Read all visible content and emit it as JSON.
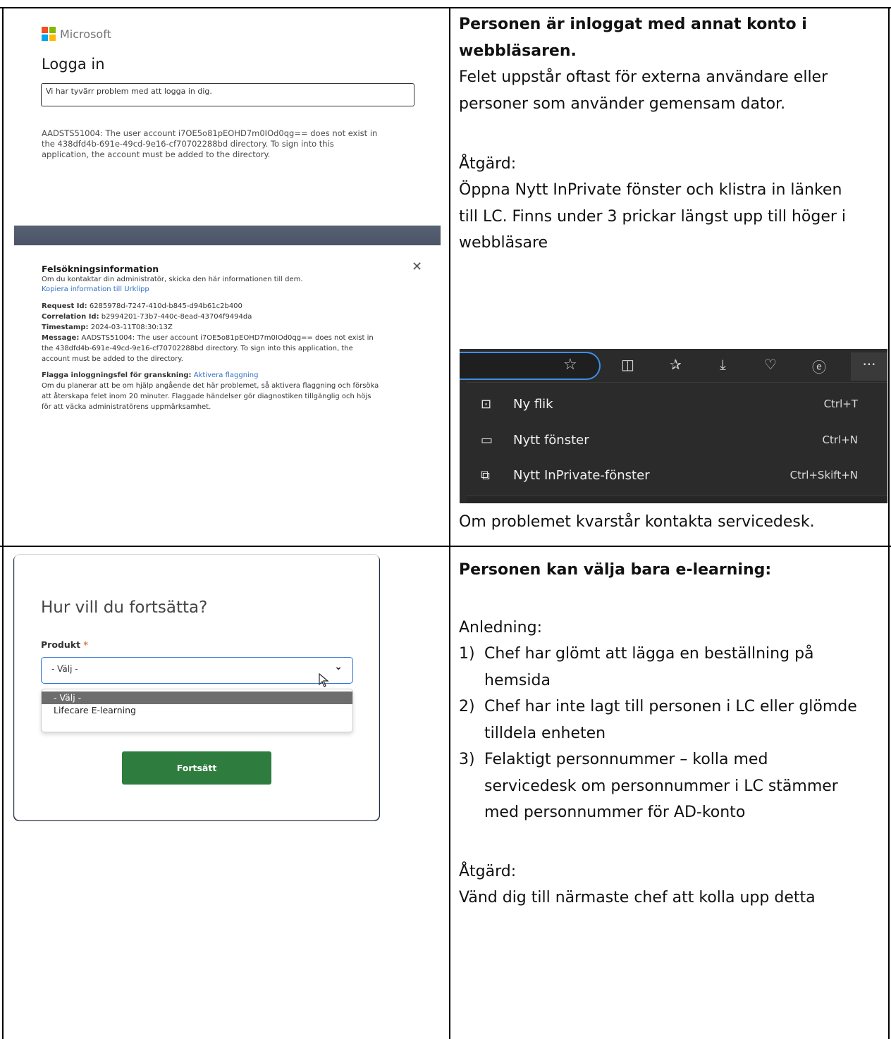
{
  "row1": {
    "heading": [
      "Personen är inloggat med annat konto i",
      "webbläsaren."
    ],
    "paragraph": [
      "Felet uppstår oftast för externa användare eller",
      "personer som använder gemensam dator."
    ],
    "action_label": "Åtgärd:",
    "action_text": [
      "Öppna Nytt InPrivate fönster och klistra in länken",
      "till LC. Finns under 3 prickar längst upp till höger i",
      "webbläsare"
    ],
    "footer": "Om problemet kvarstår kontakta servicedesk."
  },
  "ms_signin": {
    "brand": "Microsoft",
    "title": "Logga in",
    "error_box": "Vi har tyvärr problem med att logga in dig.",
    "error_lines": [
      "AADSTS51004: The user account i7OE5o81pEOHD7m0IOd0qg== does not exist in",
      "the 438dfd4b-691e-49cd-9e16-cf70702288bd directory. To sign into this",
      "application, the account must be added to the directory."
    ],
    "troubleshoot": {
      "title": "Felsökningsinformation",
      "intro": "Om du kontaktar din administratör, skicka den här informationen till dem.",
      "copy_link": "Kopiera information till Urklipp",
      "request_id_label": "Request Id:",
      "request_id": "6285978d-7247-410d-b845-d94b61c2b400",
      "correlation_id_label": "Correlation Id:",
      "correlation_id": "b2994201-73b7-440c-8ead-43704f9494da",
      "timestamp_label": "Timestamp:",
      "timestamp": "2024-03-11T08:30:13Z",
      "message_label": "Message:",
      "message_lines": [
        "AADSTS51004: The user account i7OE5o81pEOHD7m0IOd0qg== does not exist in",
        "the 438dfd4b-691e-49cd-9e16-cf70702288bd directory. To sign into this application, the",
        "account must be added to the directory."
      ],
      "flag_label": "Flagga inloggningsfel för granskning:",
      "flag_link": "Aktivera flaggning",
      "flag_lines": [
        "Om du planerar att be om hjälp angående det här problemet, så aktivera flaggning och försöka",
        "att återskapa felet inom 20 minuter. Flaggade händelser gör diagnostiken tillgänglig och höjs",
        "för att väcka administratörens uppmärksamhet."
      ]
    }
  },
  "edge_menu": {
    "items": [
      {
        "label": "Ny flik",
        "shortcut": "Ctrl+T"
      },
      {
        "label": "Nytt fönster",
        "shortcut": "Ctrl+N"
      },
      {
        "label": "Nytt InPrivate-fönster",
        "shortcut": "Ctrl+Skift+N"
      }
    ],
    "more_label": "···"
  },
  "row2": {
    "heading": "Personen kan välja bara e-learning:",
    "cause_label": "Anledning:",
    "causes": [
      {
        "num": "1)",
        "lines": [
          "Chef har glömt att lägga en beställning på",
          "hemsida"
        ]
      },
      {
        "num": "2)",
        "lines": [
          "Chef har inte lagt till personen i LC eller glömde",
          "tilldela enheten"
        ]
      },
      {
        "num": "3)",
        "lines": [
          "Felaktigt personnummer – kolla med",
          "servicedesk om personnummer i LC stämmer",
          "med personnummer för AD-konto"
        ]
      }
    ],
    "action_label": "Åtgärd:",
    "action_text": "Vänd dig till närmaste chef att kolla upp detta"
  },
  "lc_form": {
    "title": "Hur vill du fortsätta?",
    "product_label": "Produkt",
    "required_mark": "*",
    "select_value": "- Välj -",
    "options": [
      "- Välj -",
      "Lifecare E-learning"
    ],
    "button_label": "Fortsätt"
  }
}
